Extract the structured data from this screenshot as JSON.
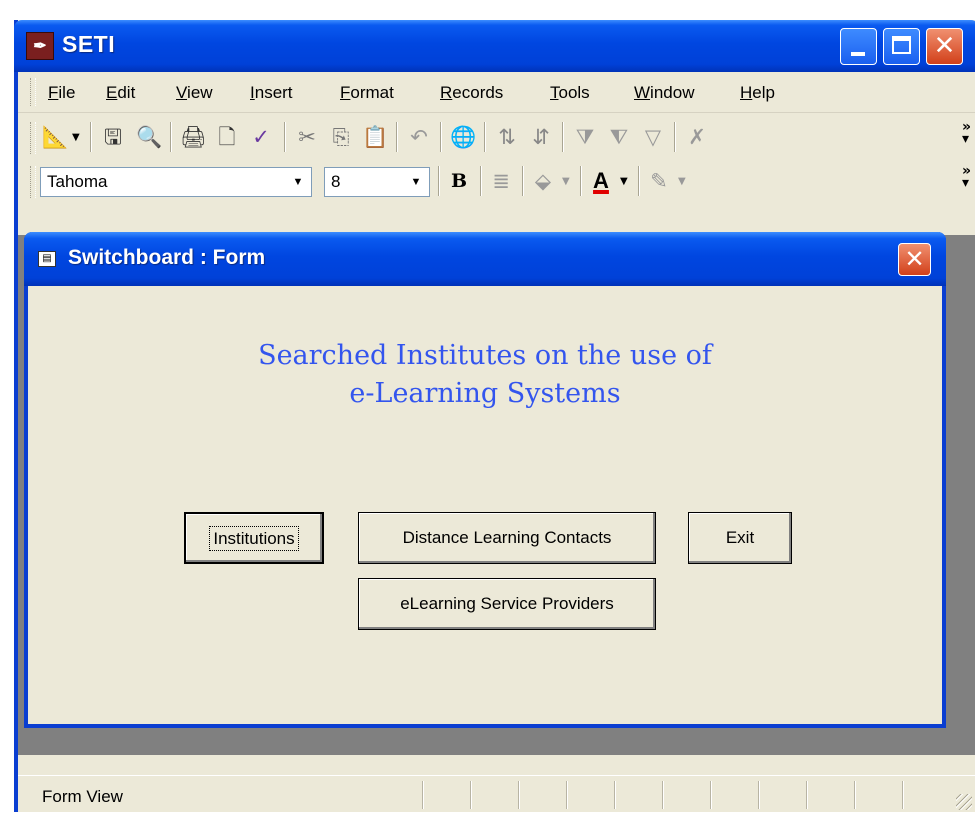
{
  "window": {
    "title": "SETI"
  },
  "menu": [
    "File",
    "Edit",
    "View",
    "Insert",
    "Format",
    "Records",
    "Tools",
    "Window",
    "Help"
  ],
  "formatting": {
    "font_name": "Tahoma",
    "font_size": "8",
    "bold_label": "B",
    "font_color_label": "A"
  },
  "form": {
    "title": "Switchboard : Form",
    "heading_line1": "Searched Institutes on the use of",
    "heading_line2": "e-Learning Systems",
    "buttons": {
      "institutions": "Institutions",
      "distance_learning_contacts": "Distance Learning Contacts",
      "exit": "Exit",
      "elearning_service_providers": "eLearning Service Providers"
    }
  },
  "status": {
    "text": "Form View"
  },
  "colors": {
    "titlebar": "#0046E0",
    "heading": "#3355EE",
    "face": "#ECE9D8"
  }
}
